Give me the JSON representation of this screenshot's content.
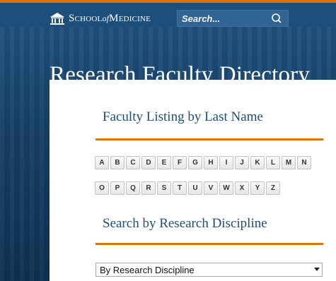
{
  "header": {
    "logo": {
      "school": "School",
      "of": "of",
      "medicine": "Medicine"
    },
    "search": {
      "placeholder": "Search..."
    }
  },
  "page": {
    "title": "Research Faculty Directory"
  },
  "listing": {
    "heading": "Faculty Listing by Last Name",
    "letters_row1": [
      "A",
      "B",
      "C",
      "D",
      "E",
      "F",
      "G",
      "H",
      "I",
      "J",
      "K",
      "L",
      "M",
      "N"
    ],
    "letters_row2": [
      "O",
      "P",
      "Q",
      "R",
      "S",
      "T",
      "U",
      "V",
      "W",
      "X",
      "Y",
      "Z"
    ]
  },
  "discipline": {
    "heading": "Search by Research Discipline",
    "select_value": "By Research Discipline"
  },
  "colors": {
    "accent_orange": "#e57200",
    "brand_blue": "#1e4e79",
    "header_blue": "#1d4f7c"
  },
  "icons": {
    "logo": "rotunda-icon",
    "search": "search-icon",
    "select": "dropdown-arrow-icon"
  }
}
